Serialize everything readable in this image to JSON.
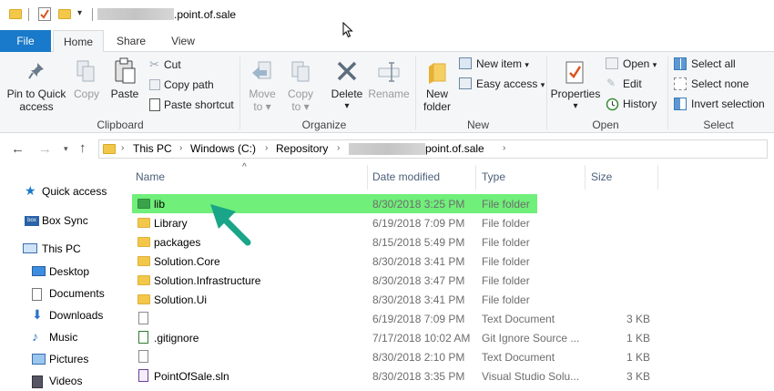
{
  "title": {
    "path_suffix": ".point.of.sale"
  },
  "tabs": {
    "file": "File",
    "home": "Home",
    "share": "Share",
    "view": "View"
  },
  "ribbon": {
    "clipboard": {
      "pin": "Pin to Quick",
      "pin2": "access",
      "copy": "Copy",
      "paste": "Paste",
      "cut": "Cut",
      "copy_path": "Copy path",
      "paste_shortcut": "Paste shortcut",
      "label": "Clipboard"
    },
    "organize": {
      "move": "Move",
      "move2": "to",
      "copy": "Copy",
      "copy2": "to",
      "delete": "Delete",
      "rename": "Rename",
      "label": "Organize"
    },
    "new": {
      "new_folder": "New",
      "new_folder2": "folder",
      "new_item": "New item",
      "easy_access": "Easy access",
      "label": "New"
    },
    "open": {
      "properties": "Properties",
      "open": "Open",
      "edit": "Edit",
      "history": "History",
      "label": "Open"
    },
    "select": {
      "select_all": "Select all",
      "select_none": "Select none",
      "invert": "Invert selection",
      "label": "Select"
    }
  },
  "address": {
    "this_pc": "This PC",
    "windows": "Windows (C:)",
    "repository": "Repository",
    "last": "point.of.sale"
  },
  "columns": {
    "name": "Name",
    "date": "Date modified",
    "type": "Type",
    "size": "Size"
  },
  "nav": [
    {
      "label": "Quick access",
      "icon": "star-icon"
    },
    {
      "label": "Box Sync",
      "icon": "box-icon"
    },
    {
      "label": "This PC",
      "icon": "computer-icon"
    },
    {
      "label": "Desktop",
      "icon": "desktop-icon"
    },
    {
      "label": "Documents",
      "icon": "documents-icon"
    },
    {
      "label": "Downloads",
      "icon": "downloads-icon"
    },
    {
      "label": "Music",
      "icon": "music-icon"
    },
    {
      "label": "Pictures",
      "icon": "pictures-icon"
    },
    {
      "label": "Videos",
      "icon": "videos-icon"
    }
  ],
  "files": [
    {
      "name": "lib",
      "date": "8/30/2018 3:25 PM",
      "type": "File folder",
      "size": "",
      "selected": true
    },
    {
      "name": "Library",
      "date": "6/19/2018 7:09 PM",
      "type": "File folder",
      "size": ""
    },
    {
      "name": "packages",
      "date": "8/15/2018 5:49 PM",
      "type": "File folder",
      "size": ""
    },
    {
      "name": "Solution.Core",
      "date": "8/30/2018 3:41 PM",
      "type": "File folder",
      "size": ""
    },
    {
      "name": "Solution.Infrastructure",
      "date": "8/30/2018 3:47 PM",
      "type": "File folder",
      "size": ""
    },
    {
      "name": "Solution.Ui",
      "date": "8/30/2018 3:41 PM",
      "type": "File folder",
      "size": ""
    },
    {
      "name": "",
      "date": "6/19/2018 7:09 PM",
      "type": "Text Document",
      "size": "3 KB"
    },
    {
      "name": ".gitignore",
      "date": "7/17/2018 10:02 AM",
      "type": "Git Ignore Source ...",
      "size": "1 KB"
    },
    {
      "name": "",
      "date": "8/30/2018 2:10 PM",
      "type": "Text Document",
      "size": "1 KB"
    },
    {
      "name": "PointOfSale.sln",
      "date": "8/30/2018 3:35 PM",
      "type": "Visual Studio Solu...",
      "size": "3 KB"
    }
  ],
  "colors": {
    "file_tab": "#1979ca",
    "selection": "#70ef7a",
    "arrow": "#1aa589"
  }
}
